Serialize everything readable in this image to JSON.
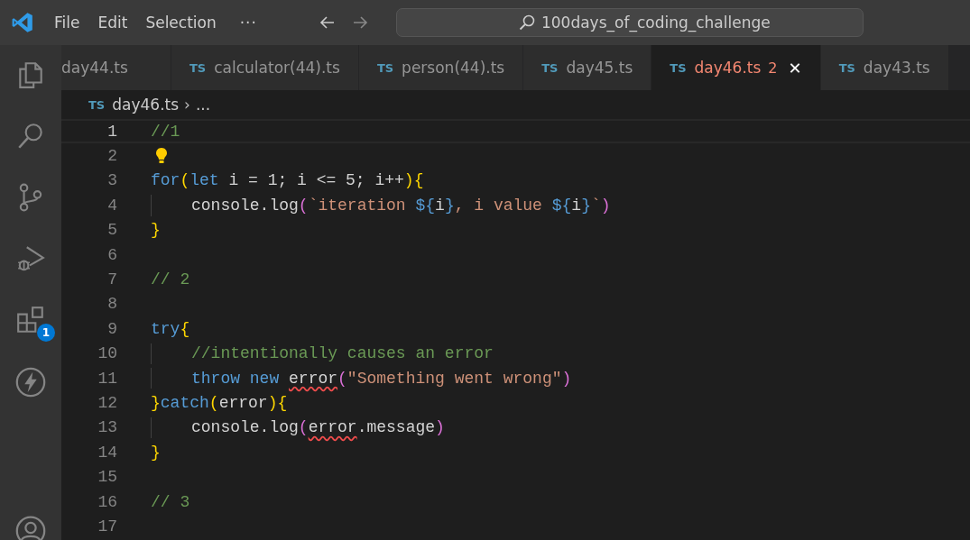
{
  "title_bar": {
    "menu": [
      "File",
      "Edit",
      "Selection"
    ],
    "more": "···",
    "search": "100days_of_coding_challenge"
  },
  "activity_bar": {
    "extensions_badge": "1"
  },
  "tabs": [
    {
      "label": "day44.ts",
      "selected": false
    },
    {
      "label": "calculator(44).ts",
      "badge": "TS",
      "selected": false
    },
    {
      "label": "person(44).ts",
      "badge": "TS",
      "selected": false
    },
    {
      "label": "day45.ts",
      "badge": "TS",
      "selected": false
    },
    {
      "label": "day46.ts",
      "badge": "TS",
      "selected": true,
      "problems": "2",
      "close": "✕"
    },
    {
      "label": "day43.ts",
      "badge": "TS",
      "selected": false
    }
  ],
  "breadcrumb": {
    "badge": "TS",
    "file": "day46.ts",
    "separator": "›",
    "rest": "..."
  },
  "code_lines": [
    {
      "number": "1",
      "current": true,
      "lightbulb": false,
      "indent": false,
      "tokens": [
        {
          "kind": "comment",
          "text": "//1"
        }
      ]
    },
    {
      "number": "2",
      "current": false,
      "lightbulb": true,
      "indent": false
    },
    {
      "number": "3",
      "current": false,
      "lightbulb": false,
      "indent": false,
      "tokens": [
        {
          "kind": "keyword",
          "text": "for"
        },
        {
          "kind": "brace1",
          "text": "("
        },
        {
          "kind": "keyword",
          "text": "let"
        },
        {
          "kind": "text",
          "text": " i = 1; i <= 5; i++"
        },
        {
          "kind": "brace1",
          "text": "){"
        }
      ]
    },
    {
      "number": "4",
      "current": false,
      "lightbulb": false,
      "indent": true,
      "tokens": [
        {
          "kind": "text",
          "text": "console.log"
        },
        {
          "kind": "brace2",
          "text": "("
        },
        {
          "kind": "string",
          "text": "`iteration "
        },
        {
          "kind": "keyword",
          "text": "${"
        },
        {
          "kind": "text",
          "text": "i"
        },
        {
          "kind": "keyword",
          "text": "}"
        },
        {
          "kind": "string",
          "text": ", i value "
        },
        {
          "kind": "keyword",
          "text": "${"
        },
        {
          "kind": "text",
          "text": "i"
        },
        {
          "kind": "keyword",
          "text": "}"
        },
        {
          "kind": "string",
          "text": "`"
        },
        {
          "kind": "brace2",
          "text": ")"
        }
      ]
    },
    {
      "number": "5",
      "current": false,
      "lightbulb": false,
      "indent": false,
      "tokens": [
        {
          "kind": "brace1",
          "text": "}"
        }
      ]
    },
    {
      "number": "6",
      "current": false,
      "lightbulb": false,
      "indent": false
    },
    {
      "number": "7",
      "current": false,
      "lightbulb": false,
      "indent": false,
      "tokens": [
        {
          "kind": "comment",
          "text": "// 2"
        }
      ]
    },
    {
      "number": "8",
      "current": false,
      "lightbulb": false,
      "indent": false
    },
    {
      "number": "9",
      "current": false,
      "lightbulb": false,
      "indent": false,
      "tokens": [
        {
          "kind": "keyword",
          "text": "try"
        },
        {
          "kind": "brace1",
          "text": "{"
        }
      ]
    },
    {
      "number": "10",
      "current": false,
      "lightbulb": false,
      "indent": true,
      "tokens": [
        {
          "kind": "comment",
          "text": "//intentionally causes an error"
        }
      ]
    },
    {
      "number": "11",
      "current": false,
      "lightbulb": false,
      "indent": true,
      "tokens": [
        {
          "kind": "keyword",
          "text": "throw new "
        },
        {
          "kind": "error",
          "text": "error"
        },
        {
          "kind": "brace2",
          "text": "("
        },
        {
          "kind": "string",
          "text": "\"Something went wrong\""
        },
        {
          "kind": "brace2",
          "text": ")"
        }
      ]
    },
    {
      "number": "12",
      "current": false,
      "lightbulb": false,
      "indent": false,
      "tokens": [
        {
          "kind": "brace1",
          "text": "}"
        },
        {
          "kind": "keyword",
          "text": "catch"
        },
        {
          "kind": "brace1",
          "text": "("
        },
        {
          "kind": "text",
          "text": "error"
        },
        {
          "kind": "brace1",
          "text": "){"
        }
      ]
    },
    {
      "number": "13",
      "current": false,
      "lightbulb": false,
      "indent": true,
      "tokens": [
        {
          "kind": "text",
          "text": "console.log"
        },
        {
          "kind": "brace2",
          "text": "("
        },
        {
          "kind": "error",
          "text": "error"
        },
        {
          "kind": "text",
          "text": ".message"
        },
        {
          "kind": "brace2",
          "text": ")"
        }
      ]
    },
    {
      "number": "14",
      "current": false,
      "lightbulb": false,
      "indent": false,
      "tokens": [
        {
          "kind": "brace1",
          "text": "}"
        }
      ]
    },
    {
      "number": "15",
      "current": false,
      "lightbulb": false,
      "indent": false
    },
    {
      "number": "16",
      "current": false,
      "lightbulb": false,
      "indent": false,
      "tokens": [
        {
          "kind": "comment",
          "text": "// 3"
        }
      ]
    },
    {
      "number": "17",
      "current": false,
      "lightbulb": false,
      "indent": false
    }
  ]
}
